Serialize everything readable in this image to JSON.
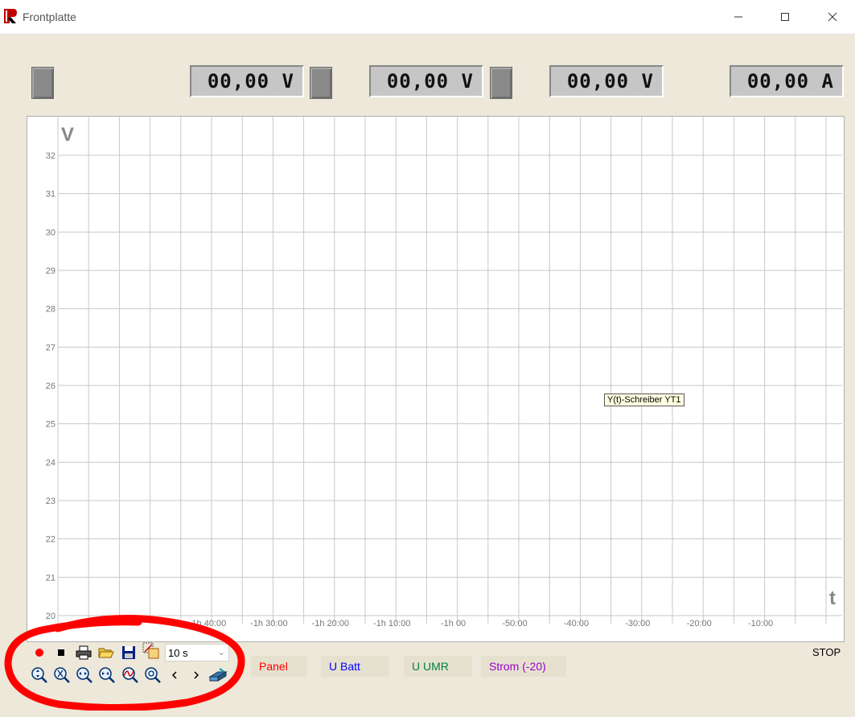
{
  "window": {
    "title": "Frontplatte"
  },
  "displays": [
    {
      "value": "00,00 V"
    },
    {
      "value": "00,00 V"
    },
    {
      "value": "00,00 V"
    },
    {
      "value": "00,00 A"
    }
  ],
  "chart_data": {
    "type": "line",
    "ylabel": "V",
    "xlabel": "t",
    "ylim": [
      20,
      32
    ],
    "y_ticks": [
      "32",
      "31",
      "30",
      "29",
      "28",
      "27",
      "26",
      "25",
      "24",
      "23",
      "22",
      "21",
      "20"
    ],
    "x_ticks": [
      "-1h 40:00",
      "-1h 30:00",
      "-1h 20:00",
      "-1h 10:00",
      "-1h 00",
      "-50:00",
      "-40:00",
      "-30:00",
      "-20:00",
      "-10:00"
    ],
    "grid": true,
    "series": []
  },
  "tooltip": {
    "text": "Y(t)-Schreiber YT1"
  },
  "toolbar": {
    "interval": "10 s"
  },
  "legend": [
    {
      "label": "Panel",
      "color": "#ff0000"
    },
    {
      "label": "U Batt",
      "color": "#0000ff"
    },
    {
      "label": "U UMR",
      "color": "#008040"
    },
    {
      "label": "Strom (-20)",
      "color": "#9900cc"
    }
  ],
  "status": {
    "text": "STOP"
  },
  "colors": {
    "annotation": "#ff0000",
    "grid": "#c8c8c8"
  }
}
